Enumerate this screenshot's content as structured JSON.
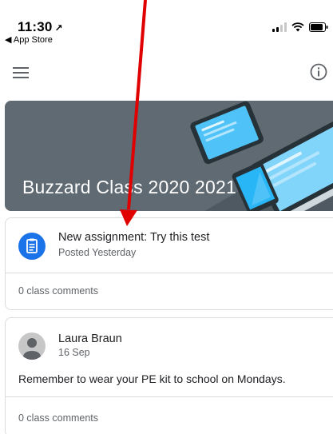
{
  "status": {
    "time": "11:30",
    "location_glyph": "↗",
    "back_app": "◀ App Store"
  },
  "app_bar": {
    "menu_icon": "hamburger-menu-icon",
    "info_icon": "info-icon"
  },
  "banner": {
    "title": "Buzzard Class 2020 2021"
  },
  "stream": [
    {
      "type": "assignment",
      "title": "New assignment: Try this test",
      "subtitle": "Posted Yesterday",
      "comments": "0 class comments"
    },
    {
      "type": "announcement",
      "author": "Laura Braun",
      "date": "16 Sep",
      "text": "Remember to wear your PE kit to school on Mondays.",
      "comments": "0 class comments"
    }
  ],
  "colors": {
    "accent": "#1a73e8",
    "annotation_arrow": "#e00000",
    "banner_bg": "#5f6a72"
  }
}
